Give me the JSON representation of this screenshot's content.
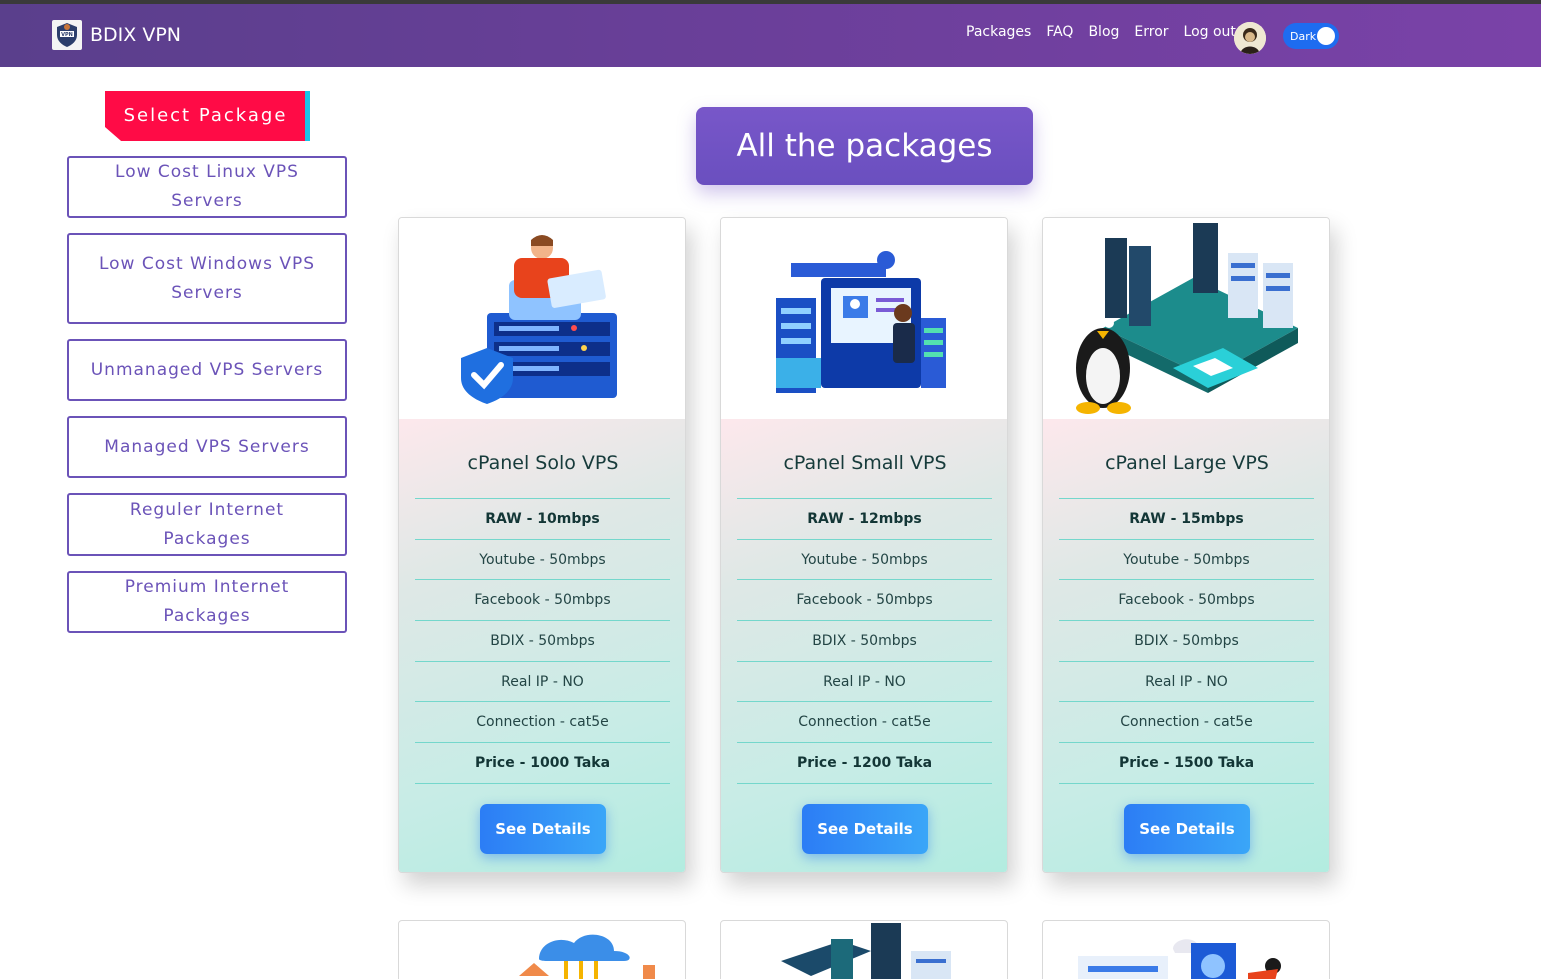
{
  "navbar": {
    "brand": "BDIX VPN",
    "links": [
      "Packages",
      "FAQ",
      "Blog",
      "Error",
      "Log out"
    ],
    "theme_toggle_label": "Dark",
    "logo_icon": "vpn-shield-icon",
    "avatar_icon": "user-avatar"
  },
  "sidebar": {
    "heading": "Select Package",
    "items": [
      "Low Cost Linux VPS Servers",
      "Low Cost Windows VPS Servers",
      "Unmanaged VPS Servers",
      "Managed VPS Servers",
      "Reguler Internet Packages",
      "Premium Internet Packages"
    ]
  },
  "main": {
    "title": "All the packages",
    "packages": [
      {
        "name": "cPanel Solo VPS",
        "features": [
          "RAW - 10mbps",
          "Youtube - 50mbps",
          "Facebook - 50mbps",
          "BDIX - 50mbps",
          "Real IP - NO",
          "Connection - cat5e",
          "Price - 1000 Taka"
        ],
        "button": "See Details",
        "image": "server-security-illustration"
      },
      {
        "name": "cPanel Small VPS",
        "features": [
          "RAW - 12mbps",
          "Youtube - 50mbps",
          "Facebook - 50mbps",
          "BDIX - 50mbps",
          "Real IP - NO",
          "Connection - cat5e",
          "Price - 1200 Taka"
        ],
        "button": "See Details",
        "image": "server-admin-illustration"
      },
      {
        "name": "cPanel Large VPS",
        "features": [
          "RAW - 15mbps",
          "Youtube - 50mbps",
          "Facebook - 50mbps",
          "BDIX - 50mbps",
          "Real IP - NO",
          "Connection - cat5e",
          "Price - 1500 Taka"
        ],
        "button": "See Details",
        "image": "linux-datacenter-illustration"
      }
    ]
  },
  "colors": {
    "navbar_start": "#5a3f8c",
    "navbar_end": "#7a42a8",
    "accent_purple": "#6b53b8",
    "select_red": "#ff0b46",
    "button_blue": "#2c7df5"
  }
}
